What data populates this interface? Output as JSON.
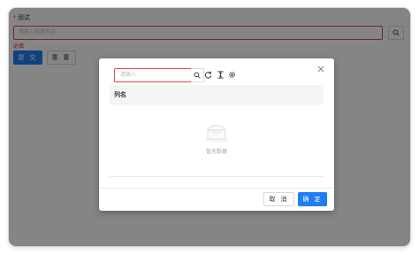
{
  "form": {
    "required_mark": "*",
    "label": "测试",
    "placeholder": "请输入搜索内容",
    "error": "必填",
    "submit_label": "提 交",
    "reset_label": "重 置"
  },
  "modal": {
    "search_placeholder": "请输入",
    "column_header": "列名",
    "empty_text": "暂无数据",
    "cancel_label": "取 消",
    "ok_label": "确 定",
    "icons": [
      "close-icon",
      "search-icon",
      "refresh-icon",
      "column-height-icon",
      "settings-icon",
      "empty-box-icon"
    ]
  },
  "colors": {
    "primary": "#1f7ef5",
    "error": "#e02020",
    "mask": "rgba(0,0,0,0.48)"
  }
}
